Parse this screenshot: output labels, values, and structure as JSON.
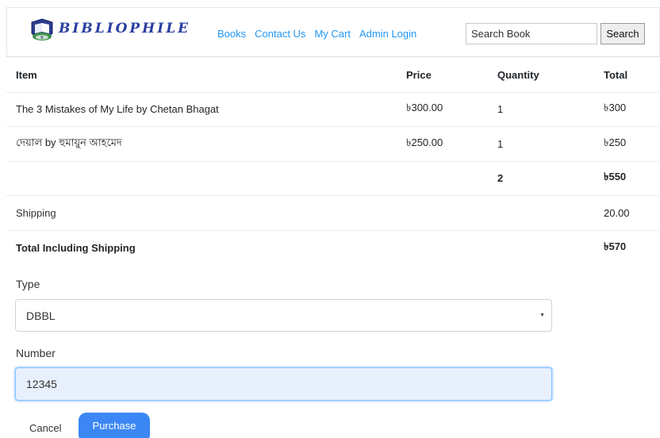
{
  "navbar": {
    "brand": "BIBLIOPHILE",
    "links": [
      "Books",
      "Contact Us",
      "My Cart",
      "Admin Login"
    ],
    "search_placeholder": "Search Book",
    "search_button": "Search"
  },
  "table": {
    "headers": {
      "item": "Item",
      "price": "Price",
      "quantity": "Quantity",
      "total": "Total"
    },
    "rows": [
      {
        "item": "The 3 Mistakes of My Life by Chetan Bhagat",
        "price": "৳300.00",
        "quantity": "1",
        "total": "৳300"
      },
      {
        "item": "দেয়াল by হুমায়ুন আহমেদ",
        "price": "৳250.00",
        "quantity": "1",
        "total": "৳250"
      }
    ],
    "subtotal": {
      "quantity": "2",
      "total": "৳550"
    },
    "shipping": {
      "label": "Shipping",
      "value": "20.00"
    },
    "grand_total": {
      "label": "Total Including Shipping",
      "value": "৳570"
    }
  },
  "form": {
    "type_label": "Type",
    "type_value": "DBBL",
    "number_label": "Number",
    "number_value": "12345",
    "cancel_label": "Cancel",
    "purchase_label": "Purchase"
  },
  "colors": {
    "link": "#2196f3",
    "brand": "#2a3f9e",
    "primary_button": "#3b87f5",
    "autofill_bg": "#e8f0fe"
  },
  "icons": [
    "book-logo-icon",
    "select-caret-icon"
  ]
}
